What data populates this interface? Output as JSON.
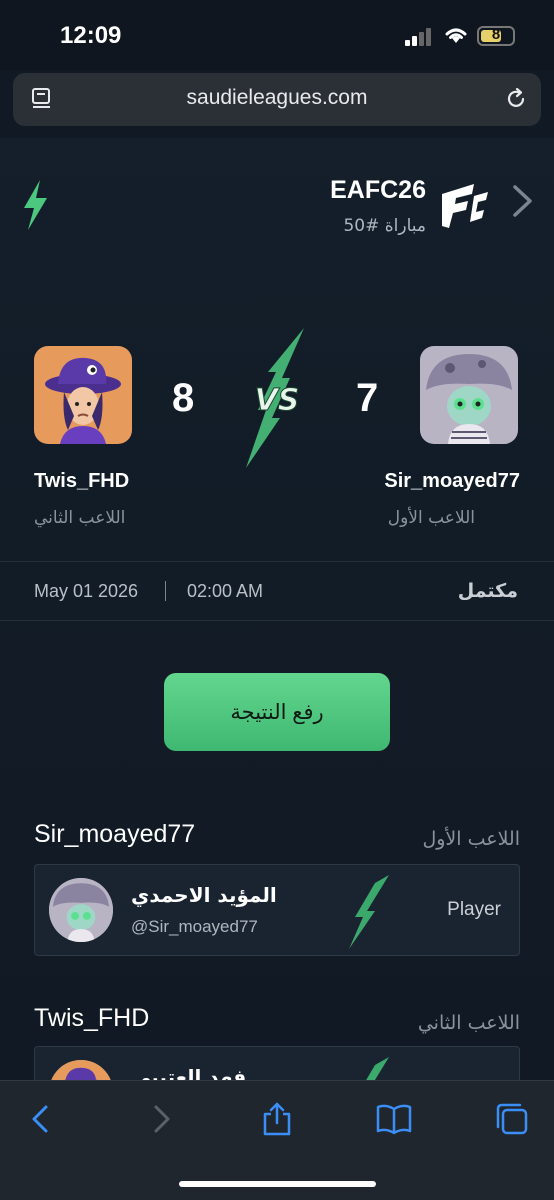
{
  "status_bar": {
    "time": "12:09",
    "battery": "8"
  },
  "browser": {
    "url": "saudieleagues.com"
  },
  "match": {
    "game": "EAFC26",
    "match_number": "مباراة #50",
    "player1": {
      "name": "Twis_FHD",
      "score": "8",
      "role": "اللاعب الثاني"
    },
    "player2": {
      "name": "Sir_moayed77",
      "score": "7",
      "role": "اللاعب الأول"
    },
    "date": "May 01 2026",
    "time": "02:00 AM",
    "status": "مكتمل"
  },
  "upload_button": "رفع النتيجة",
  "sections": [
    {
      "username": "Sir_moayed77",
      "role": "اللاعب الأول",
      "display_name": "المؤيد الاحمدي",
      "handle": "@Sir_moayed77",
      "tag": "Player"
    },
    {
      "username": "Twis_FHD",
      "role": "اللاعب الثاني",
      "display_name": "فهد العتيبي"
    }
  ],
  "colors": {
    "accent": "#4cc97f",
    "background": "#111a24"
  },
  "icons": [
    "reader-icon",
    "reload-icon",
    "bolt-icon",
    "fc-logo-icon",
    "chevron-right-icon",
    "back-icon",
    "forward-icon",
    "share-icon",
    "bookmarks-icon",
    "tabs-icon"
  ]
}
